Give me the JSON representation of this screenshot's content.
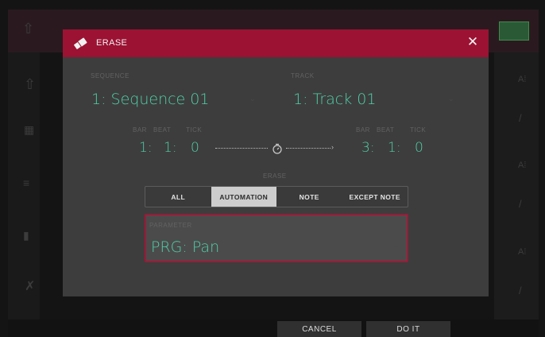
{
  "dialog": {
    "title": "ERASE",
    "icon": "eraser-icon",
    "sequence": {
      "label": "SEQUENCE",
      "value": "1: Sequence 01"
    },
    "track": {
      "label": "TRACK",
      "value": "1: Track 01"
    },
    "start": {
      "bar_label": "BAR",
      "beat_label": "BEAT",
      "tick_label": "TICK",
      "bar": "1:",
      "beat": "1:",
      "tick": "0"
    },
    "end": {
      "bar_label": "BAR",
      "beat_label": "BEAT",
      "tick_label": "TICK",
      "bar": "3:",
      "beat": "1:",
      "tick": "0"
    },
    "erase_label": "ERASE",
    "erase_modes": [
      "ALL",
      "AUTOMATION",
      "NOTE",
      "EXCEPT NOTE"
    ],
    "selected_mode": "AUTOMATION",
    "parameter": {
      "label": "PARAMETER",
      "value": "PRG: Pan"
    },
    "accent_color": "#4fd0a8",
    "header_color": "#9c1233"
  },
  "footer": {
    "cancel": "CANCEL",
    "do_it": "DO IT"
  }
}
